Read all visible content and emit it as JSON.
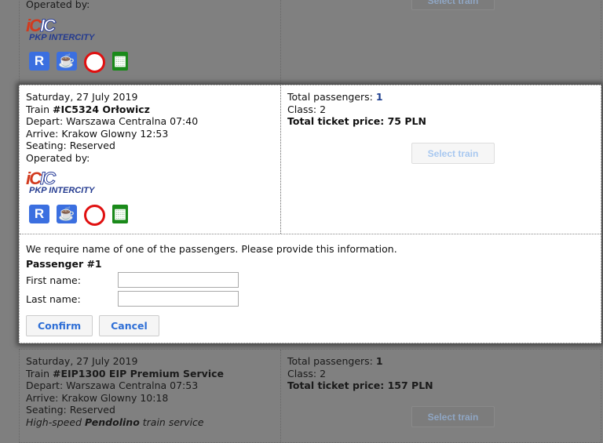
{
  "top_card": {
    "operated_label": "Operated by:",
    "operator": "PKP INTERCITY",
    "select_label": "Select train"
  },
  "modal_card": {
    "date": "Saturday, 27 July 2019",
    "train_prefix": "Train ",
    "train": "#IC5324 Orłowicz",
    "depart": "Depart: Warszawa Centralna 07:40",
    "arrive": "Arrive: Krakow Glowny 12:53",
    "seating": "Seating: Reserved",
    "operated_label": "Operated by:",
    "operator": "PKP INTERCITY",
    "passengers_label": "Total passengers: ",
    "passengers": "1",
    "class": "Class: 2",
    "price": "Total ticket price: 75 PLN",
    "select_label": "Select train",
    "amenities": [
      "reservation-icon",
      "restaurant-cup-icon",
      "no-smoking-icon",
      "mobile-ticket-icon"
    ]
  },
  "form": {
    "message": "We require name of one of the passengers. Please provide this information.",
    "passenger_heading": "Passenger #1",
    "first_name_label": "First name:",
    "first_name_value": "",
    "last_name_label": "Last name:",
    "last_name_value": "",
    "confirm": "Confirm",
    "cancel": "Cancel"
  },
  "bottom_card": {
    "date": "Saturday, 27 July 2019",
    "train_prefix": "Train ",
    "train": "#EIP1300 EIP Premium Service",
    "depart": "Depart: Warszawa Centralna 07:53",
    "arrive": "Arrive: Krakow Glowny 10:18",
    "seating": "Seating: Reserved",
    "note_pre": "High-speed ",
    "note_bold": "Pendolino",
    "note_post": " train service",
    "passengers_label": "Total passengers: ",
    "passengers": "1",
    "class": "Class: 2",
    "price": "Total ticket price: 157 PLN",
    "select_label": "Select train"
  }
}
